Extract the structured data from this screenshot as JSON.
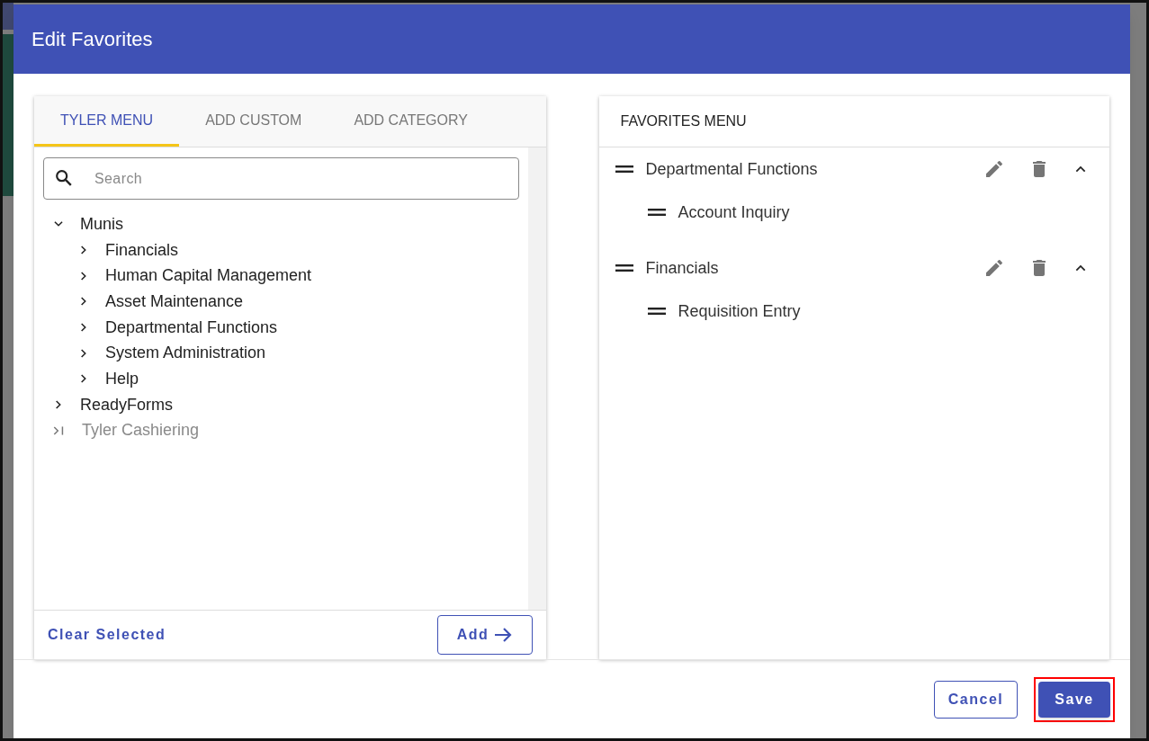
{
  "dialog": {
    "title": "Edit Favorites"
  },
  "tabs": [
    {
      "label": "TYLER MENU",
      "selected": true
    },
    {
      "label": "ADD CUSTOM",
      "selected": false
    },
    {
      "label": "ADD CATEGORY",
      "selected": false
    }
  ],
  "search": {
    "placeholder": "Search"
  },
  "tree": [
    {
      "label": "Munis",
      "expanded": true,
      "disabled": false,
      "children": [
        {
          "label": "Financials",
          "expanded": false,
          "disabled": false
        },
        {
          "label": "Human Capital Management",
          "expanded": false,
          "disabled": false
        },
        {
          "label": "Asset Maintenance",
          "expanded": false,
          "disabled": false
        },
        {
          "label": "Departmental Functions",
          "expanded": false,
          "disabled": false
        },
        {
          "label": "System Administration",
          "expanded": false,
          "disabled": false
        },
        {
          "label": "Help",
          "expanded": false,
          "disabled": false
        }
      ]
    },
    {
      "label": "ReadyForms",
      "expanded": false,
      "disabled": false
    },
    {
      "label": "Tyler Cashiering",
      "expanded": false,
      "disabled": true
    }
  ],
  "left_footer": {
    "clear": "Clear Selected",
    "add": "Add"
  },
  "favorites": {
    "heading": "FAVORITES MENU",
    "groups": [
      {
        "label": "Departmental Functions",
        "expanded": true,
        "items": [
          "Account Inquiry"
        ]
      },
      {
        "label": "Financials",
        "expanded": true,
        "items": [
          "Requisition Entry"
        ]
      }
    ]
  },
  "buttons": {
    "cancel": "Cancel",
    "save": "Save"
  },
  "save_highlighted": true
}
